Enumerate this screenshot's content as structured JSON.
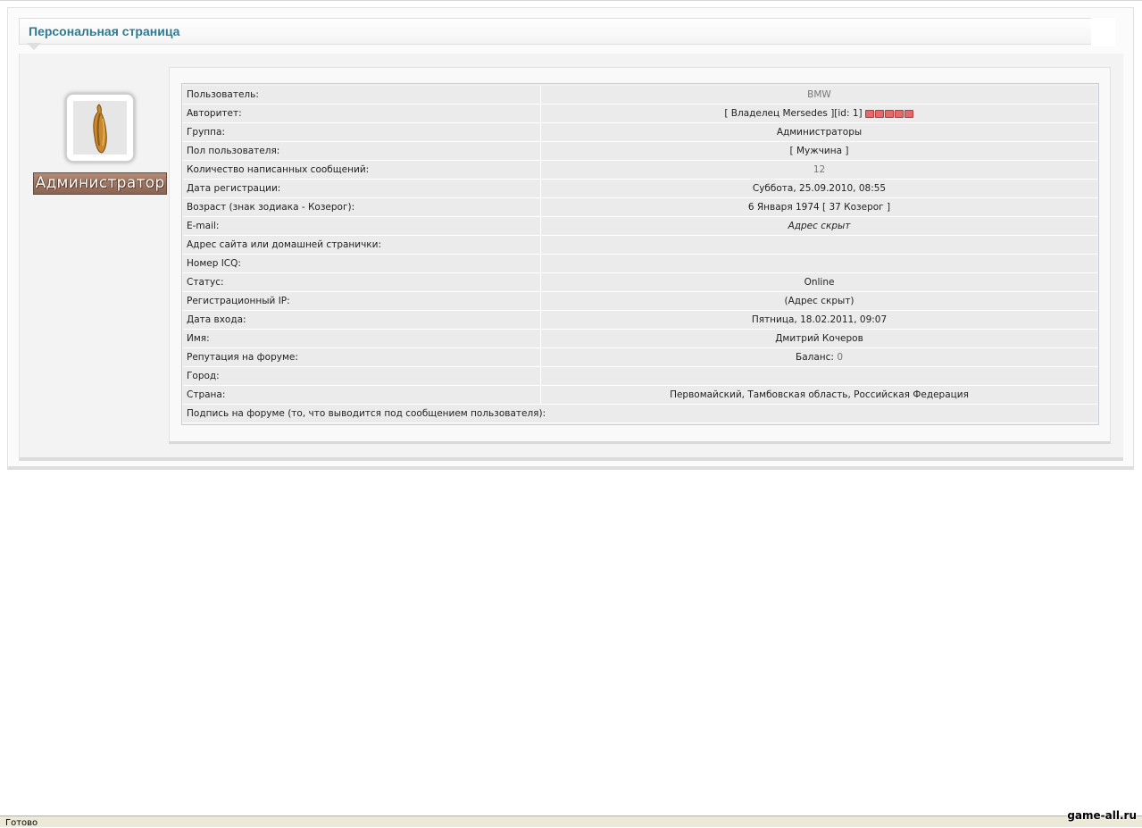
{
  "header": {
    "title": "Персональная страница"
  },
  "profile": {
    "rank_badge": "Администратор",
    "rows": [
      {
        "label": "Пользователь:",
        "value": "BMW"
      },
      {
        "label": "Авторитет:",
        "value": "[ Владелец Mersedes ][id: 1]",
        "rating_dots": 5,
        "rating_color": "#e26a6a"
      },
      {
        "label": "Группа:",
        "value": "Администраторы"
      },
      {
        "label": "Пол пользователя:",
        "value": "[ Мужчина ]"
      },
      {
        "label": "Количество написанных сообщений:",
        "value": "12"
      },
      {
        "label": "Дата регистрации:",
        "value": "Суббота, 25.09.2010, 08:55"
      },
      {
        "label": "Возраст (знак зодиака - Козерог):",
        "value": "6 Января 1974 [ 37 Козерог ]"
      },
      {
        "label": "E-mail:",
        "value": "Адрес скрыт"
      },
      {
        "label": "Адрес сайта или домашней странички:",
        "value": ""
      },
      {
        "label": "Номер ICQ:",
        "value": ""
      },
      {
        "label": "Статус:",
        "value": "Online"
      },
      {
        "label": "Регистрационный IP:",
        "value": "(Адрес скрыт)"
      },
      {
        "label": "Дата входа:",
        "value": "Пятница, 18.02.2011, 09:07"
      },
      {
        "label": "Имя:",
        "value": "Дмитрий Кочеров"
      },
      {
        "label": "Репутация на форуме:",
        "value_prefix": "Баланс:",
        "value": "0"
      },
      {
        "label": "Город:",
        "value": ""
      },
      {
        "label": "Страна:",
        "value": "Первомайский, Тамбовская область, Российская Федерация"
      },
      {
        "label": "Подпись на форуме (то, что выводится под сообщением пользователя):"
      }
    ]
  },
  "statusbar": {
    "text": "Готово"
  },
  "watermark": {
    "text": "game-all.ru"
  },
  "colors": {
    "title": "#2e7b94",
    "badge": "#8a6452"
  }
}
